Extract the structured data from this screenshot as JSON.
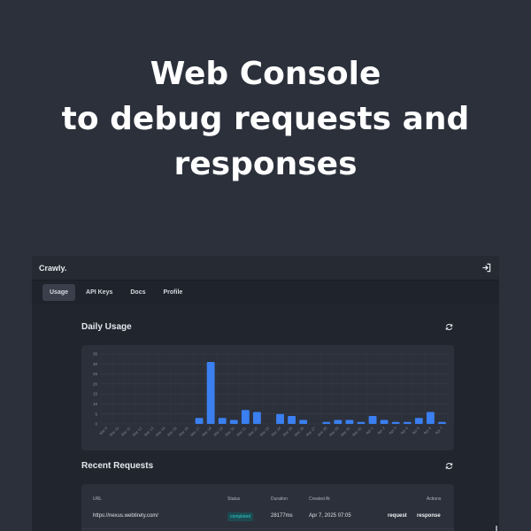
{
  "headline": {
    "line1": "Web Console",
    "line2": "to debug requests and",
    "line3": "responses"
  },
  "app": {
    "brand": "Crawly.",
    "logout_icon": "logout-icon"
  },
  "nav": {
    "tabs": [
      {
        "label": "Usage",
        "active": true
      },
      {
        "label": "API Keys",
        "active": false
      },
      {
        "label": "Docs",
        "active": false
      },
      {
        "label": "Profile",
        "active": false
      }
    ]
  },
  "usage": {
    "title": "Daily Usage",
    "refresh_icon": "refresh-icon"
  },
  "chart_data": {
    "type": "bar",
    "categories": [
      "Mar 9",
      "Mar 10",
      "Mar 11",
      "Mar 12",
      "Mar 13",
      "Mar 14",
      "Mar 15",
      "Mar 16",
      "Mar 17",
      "Mar 18",
      "Mar 19",
      "Mar 20",
      "Mar 21",
      "Mar 22",
      "Mar 23",
      "Mar 24",
      "Mar 25",
      "Mar 26",
      "Mar 27",
      "Mar 28",
      "Mar 29",
      "Mar 30",
      "Mar 31",
      "Apr 1",
      "Apr 2",
      "Apr 3",
      "Apr 4",
      "Apr 5",
      "Apr 6",
      "Apr 7"
    ],
    "values": [
      0,
      0,
      0,
      0,
      0,
      0,
      0,
      0,
      3,
      31,
      3,
      2,
      7,
      6,
      0,
      5,
      4,
      2,
      0,
      1,
      2,
      2,
      1,
      4,
      2,
      1,
      1,
      3,
      6,
      1
    ],
    "yticks": [
      0,
      5,
      10,
      15,
      20,
      25,
      30,
      35
    ],
    "ylim": [
      0,
      35
    ],
    "grid": true,
    "bar_color": "#3b7ff0"
  },
  "requests": {
    "title": "Recent Requests",
    "refresh_icon": "refresh-icon",
    "columns": {
      "url": "URL",
      "status": "Status",
      "duration": "Duration",
      "created": "Created At",
      "actions": "Actions"
    },
    "rows": [
      {
        "url": "https://nexus.webtirety.com/",
        "status": "completed",
        "duration": "28177ms",
        "created": "Apr 7, 2025 07:05",
        "action_request": "request",
        "action_response": "response"
      }
    ]
  },
  "colors": {
    "page_bg": "#2b303b",
    "console_bg": "#1f232b",
    "card_bg": "#2b303a",
    "accent": "#3b7ff0",
    "status_completed": "#2ad0c8"
  }
}
